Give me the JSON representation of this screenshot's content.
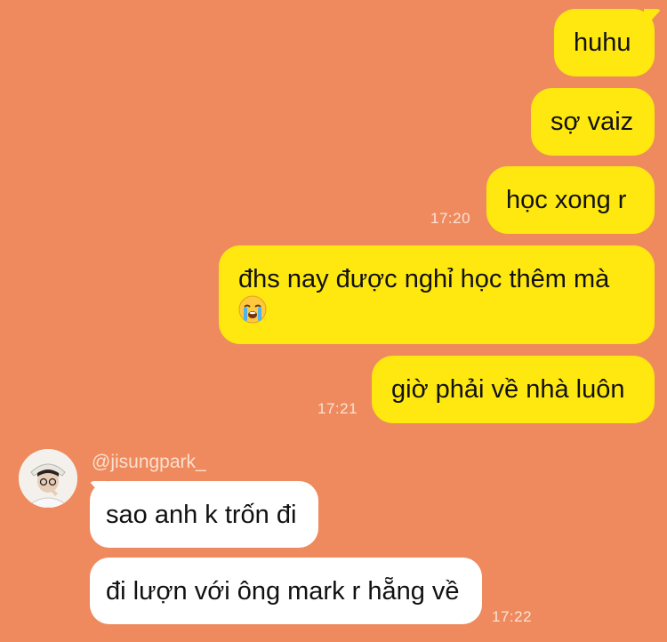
{
  "colors": {
    "background": "#EE8A5E",
    "outgoing_bubble": "#FFE80F",
    "incoming_bubble": "#FFFFFF"
  },
  "messages": {
    "m1": "huhu",
    "m2": "sợ vaiz",
    "m3": "học xong r",
    "m4": "đhs nay được nghỉ học thêm mà",
    "m4_emoji": "crying-face-emoji",
    "m5": "giờ phải về nhà luôn",
    "m6": "sao anh k trốn đi",
    "m7": "đi lượn với ông mark r hẵng về"
  },
  "timestamps": {
    "t1": "17:20",
    "t2": "17:21",
    "t3": "17:22"
  },
  "contact": {
    "username": "@jisungpark_",
    "avatar_icon": "profile-photo"
  }
}
